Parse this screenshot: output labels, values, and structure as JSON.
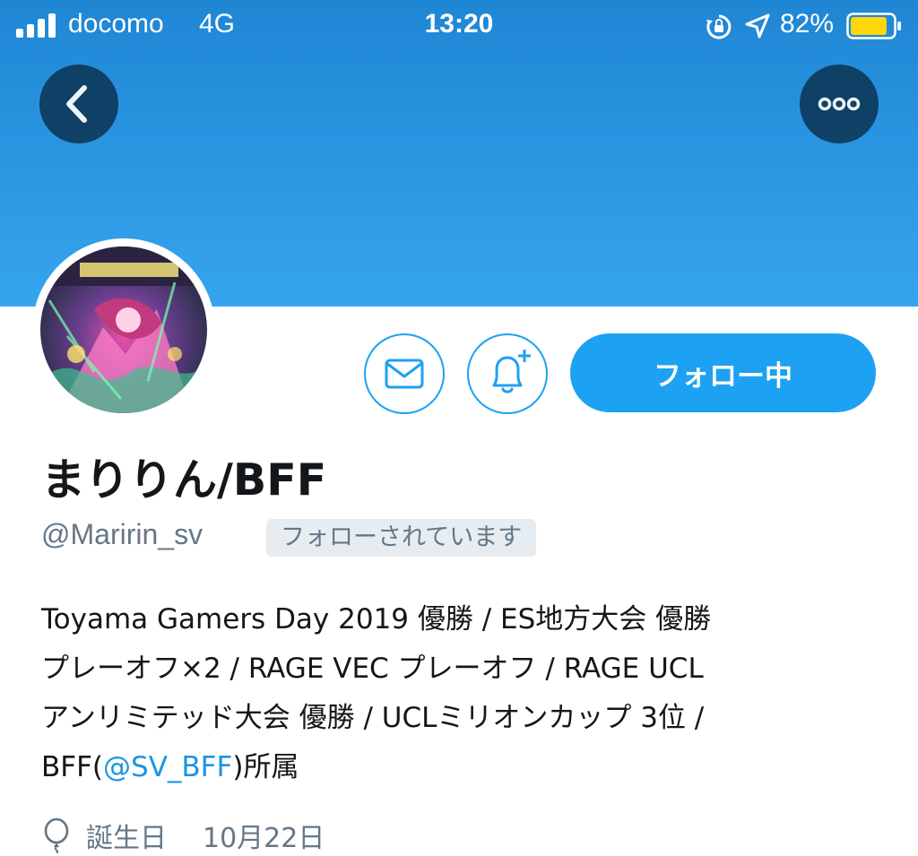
{
  "status_bar": {
    "carrier": "docomo",
    "network": "4G",
    "time": "13:20",
    "battery_percent": "82%",
    "icons": [
      "signal-bars-icon",
      "orientation-lock-icon",
      "location-arrow-icon",
      "battery-icon"
    ]
  },
  "nav": {
    "back_icon": "chevron-left-icon",
    "more_icon": "ellipsis-icon"
  },
  "profile": {
    "display_name": "まりりん/BFF",
    "handle": "@Maririn_sv",
    "follows_you_badge": "フォローされています",
    "bio_lines": [
      "Toyama Gamers Day 2019 優勝 / ES地方大会 優勝",
      "プレーオフ×2 / RAGE VEC プレーオフ / RAGE UCL",
      "アンリミテッド大会 優勝 / UCLミリオンカップ 3位 /"
    ],
    "bio_last_prefix": "BFF(",
    "bio_mention": "@SV_BFF",
    "bio_last_suffix": ")所属",
    "birthday_label": "誕生日",
    "birthday_value": "10月22日"
  },
  "actions": {
    "message_icon": "envelope-icon",
    "notify_icon": "bell-plus-icon",
    "follow_button_label": "フォロー中"
  },
  "colors": {
    "accent": "#1da1f2",
    "banner": "#2b97e3",
    "secondary_text": "#657786",
    "badge_bg": "#e6ecf0"
  }
}
